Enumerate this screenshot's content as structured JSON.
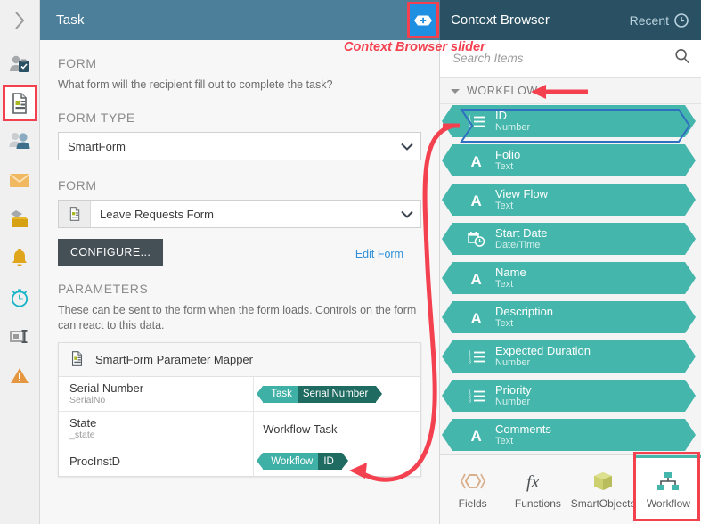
{
  "colors": {
    "header_left_bg": "#4c7f99",
    "header_right_bg": "#2a5163",
    "slider_btn_bg": "#1e8fe1",
    "highlight_red": "#f4414f",
    "teal": "#45b6ac",
    "teal_dark": "#1f6b62",
    "link_blue": "#2f8fd8"
  },
  "rail": {
    "toggle_icon": "chevron-right-icon",
    "items": [
      {
        "name": "recipients-icon",
        "selected": false
      },
      {
        "name": "form-icon",
        "selected": true
      },
      {
        "name": "participants-icon",
        "selected": false
      },
      {
        "name": "email-icon",
        "selected": false
      },
      {
        "name": "actions-icon",
        "selected": false
      },
      {
        "name": "notifications-icon",
        "selected": false
      },
      {
        "name": "escalations-icon",
        "selected": false
      },
      {
        "name": "outcomes-icon",
        "selected": false
      },
      {
        "name": "warnings-icon",
        "selected": false
      }
    ]
  },
  "header": {
    "task_title": "Task",
    "slider_icon": "context-browser-slider-icon",
    "context_browser_title": "Context Browser",
    "recent_label": "Recent",
    "recent_icon": "clock-icon"
  },
  "annotations": {
    "slider_note": "Context Browser slider"
  },
  "form_panel": {
    "form_section_label": "FORM",
    "form_help": "What form will the recipient fill out to complete the task?",
    "form_type_label": "FORM TYPE",
    "form_type_value": "SmartForm",
    "form_label": "FORM",
    "form_value": "Leave Requests Form",
    "configure_label": "CONFIGURE...",
    "edit_form_label": "Edit Form",
    "parameters_label": "PARAMETERS",
    "parameters_help": "These can be sent to the form when the form loads. Controls on the form can react to  this data.",
    "mapper_title": "SmartForm Parameter Mapper",
    "mapper_rows": [
      {
        "name": "Serial Number",
        "sub": "SerialNo",
        "value_type": "chip",
        "chip_left": "Task",
        "chip_right": "Serial Number"
      },
      {
        "name": "State",
        "sub": "_state",
        "value_type": "text",
        "value": "Workflow Task"
      },
      {
        "name": "ProcInstD",
        "sub": "",
        "value_type": "chip",
        "chip_left": "Workflow",
        "chip_right": "ID"
      }
    ]
  },
  "context_browser": {
    "search_placeholder": "Search Items",
    "search_icon": "search-icon",
    "group_label": "WORKFLOW",
    "items": [
      {
        "label": "ID",
        "type": "Number",
        "icon": "number-list-icon",
        "selected": true
      },
      {
        "label": "Folio",
        "type": "Text",
        "icon": "text-a-icon",
        "selected": false
      },
      {
        "label": "View Flow",
        "type": "Text",
        "icon": "text-a-icon",
        "selected": false
      },
      {
        "label": "Start Date",
        "type": "Date/Time",
        "icon": "calendar-clock-icon",
        "selected": false
      },
      {
        "label": "Name",
        "type": "Text",
        "icon": "text-a-icon",
        "selected": false
      },
      {
        "label": "Description",
        "type": "Text",
        "icon": "text-a-icon",
        "selected": false
      },
      {
        "label": "Expected Duration",
        "type": "Number",
        "icon": "number-list-icon",
        "selected": false
      },
      {
        "label": "Priority",
        "type": "Number",
        "icon": "number-list-icon",
        "selected": false
      },
      {
        "label": "Comments",
        "type": "Text",
        "icon": "text-a-icon",
        "selected": false
      }
    ],
    "tabs": [
      {
        "label": "Fields",
        "icon": "fields-icon",
        "active": false
      },
      {
        "label": "Functions",
        "icon": "functions-fx-icon",
        "active": false
      },
      {
        "label": "SmartObjects",
        "icon": "smartobjects-cube-icon",
        "active": false
      },
      {
        "label": "Workflow",
        "icon": "workflow-hierarchy-icon",
        "active": true
      }
    ]
  }
}
